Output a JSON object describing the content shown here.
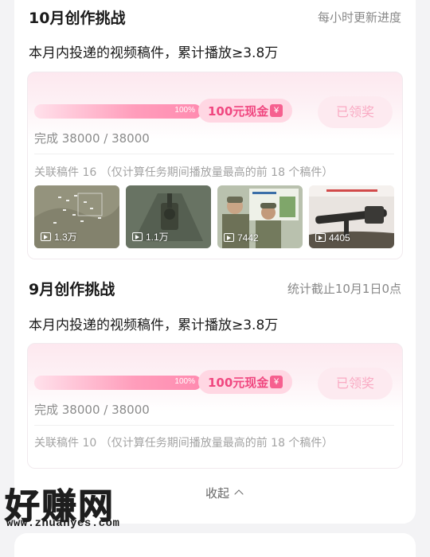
{
  "challenges": [
    {
      "title": "10月创作挑战",
      "note": "每小时更新进度",
      "description": "本月内投递的视频稿件，累计播放≥3.8万",
      "progress": {
        "percent_label": "100%",
        "fraction": 1.0
      },
      "reward_label": "100元现金",
      "reward_icon": "yen-icon",
      "claim_label": "已领奖",
      "completed_text": "完成 38000 / 38000",
      "related_text": "关联稿件 16 （仅计算任务期间播放量最高的前 18 个稿件）",
      "videos": [
        {
          "views": "1.3万"
        },
        {
          "views": "1.1万"
        },
        {
          "views": "7442"
        },
        {
          "views": "4405"
        }
      ]
    },
    {
      "title": "9月创作挑战",
      "note": "统计截止10月1日0点",
      "description": "本月内投递的视频稿件，累计播放≥3.8万",
      "progress": {
        "percent_label": "100%",
        "fraction": 1.0
      },
      "reward_label": "100元现金",
      "reward_icon": "yen-icon",
      "claim_label": "已领奖",
      "completed_text": "完成 38000 / 38000",
      "related_text": "关联稿件 10 （仅计算任务期间播放量最高的前 18 个稿件）"
    }
  ],
  "collapse_label": "收起",
  "watermark": {
    "main": "好赚网",
    "url": "www.zhuanyes.com"
  },
  "colors": {
    "accent": "#f0467f",
    "progress": "#ff8bb0",
    "claimed": "#f9aac3"
  }
}
